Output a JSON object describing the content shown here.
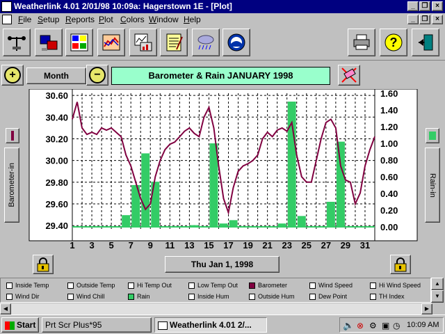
{
  "window": {
    "title": "Weatherlink 4.01    2/01/98  10:09a: Hagerstown 1E - [Plot]"
  },
  "menu": [
    "File",
    "Setup",
    "Reports",
    "Plot",
    "Colors",
    "Window",
    "Help"
  ],
  "menu_underline": [
    "F",
    "S",
    "R",
    "P",
    "C",
    "W",
    "H"
  ],
  "controls": {
    "zoom_in": "+",
    "zoom_out": "−",
    "period_label": "Month",
    "plot_title": "Barometer & Rain JANUARY 1998",
    "date_label": "Thu Jan 1, 1998",
    "left_axis_label": "Barometer-in",
    "right_axis_label": "Rain-in"
  },
  "legend": [
    [
      "Inside Temp",
      "Outside Temp",
      "Hi Temp Out",
      "Low Temp Out",
      "Barometer",
      "Wind Speed",
      "Hi Wind Speed"
    ],
    [
      "Wind Dir",
      "Wind Chill",
      "Rain",
      "Inside Hum",
      "Outside Hum",
      "Dew Point",
      "TH Index"
    ]
  ],
  "legend_colors": {
    "Barometer": "#800040",
    "Rain": "#33cc66"
  },
  "taskbar": {
    "start": "Start",
    "task1": "Prt Scr Plus*95",
    "task2": "Weatherlink 4.01    2/...",
    "clock": "10:09 AM"
  },
  "colors": {
    "barometer_line": "#800040",
    "rain_bar": "#33cc66",
    "title_bg": "#99ffcc"
  },
  "chart_data": {
    "type": "line",
    "title": "Barometer & Rain JANUARY 1998",
    "ylabel": "Barometer-in",
    "y2label": "Rain-in",
    "x_ticks": [
      "1",
      "3",
      "5",
      "7",
      "9",
      "11",
      "13",
      "15",
      "17",
      "19",
      "21",
      "23",
      "25",
      "27",
      "29",
      "31"
    ],
    "xlim": [
      1,
      32
    ],
    "ylim": [
      29.35,
      30.62
    ],
    "y2lim": [
      -0.05,
      1.6
    ],
    "y_ticks": [
      "29.40",
      "29.60",
      "29.80",
      "30.00",
      "30.20",
      "30.40",
      "30.60"
    ],
    "y2_ticks": [
      "0.00",
      "0.20",
      "0.40",
      "0.60",
      "0.80",
      "1.00",
      "1.20",
      "1.40",
      "1.60"
    ],
    "grid": true,
    "series": [
      {
        "name": "Barometer",
        "x": [
          1.0,
          1.5,
          2.0,
          2.5,
          3.0,
          3.5,
          4.0,
          4.5,
          5.0,
          5.5,
          6.0,
          6.5,
          7.0,
          7.5,
          8.0,
          8.5,
          9.0,
          9.5,
          10.0,
          10.5,
          11.0,
          11.5,
          12.0,
          12.5,
          13.0,
          13.5,
          14.0,
          14.5,
          15.0,
          15.5,
          16.0,
          16.5,
          17.0,
          17.5,
          18.0,
          18.5,
          19.0,
          19.5,
          20.0,
          20.5,
          21.0,
          21.5,
          22.0,
          22.5,
          23.0,
          23.5,
          24.0,
          24.5,
          25.0,
          25.5,
          26.0,
          26.5,
          27.0,
          27.5,
          28.0,
          28.5,
          29.0,
          29.5,
          30.0,
          30.5,
          31.0,
          31.5,
          32.0
        ],
        "values": [
          30.38,
          30.54,
          30.3,
          30.24,
          30.26,
          30.24,
          30.3,
          30.28,
          30.3,
          30.26,
          30.22,
          30.05,
          29.95,
          29.8,
          29.65,
          29.55,
          29.6,
          29.85,
          30.0,
          30.1,
          30.15,
          30.17,
          30.22,
          30.27,
          30.3,
          30.25,
          30.22,
          30.4,
          30.49,
          30.3,
          29.95,
          29.65,
          29.52,
          29.75,
          29.9,
          29.95,
          29.97,
          30.0,
          30.05,
          30.2,
          30.26,
          30.22,
          30.28,
          30.3,
          30.27,
          30.35,
          30.05,
          29.85,
          29.8,
          29.8,
          30.0,
          30.2,
          30.35,
          30.38,
          30.3,
          29.95,
          29.82,
          29.8,
          29.6,
          29.7,
          29.95,
          30.1,
          30.22
        ]
      },
      {
        "name": "Rain",
        "type": "bar",
        "x": [
          6.5,
          7.5,
          8.5,
          9.5,
          13.5,
          15.5,
          16.5,
          17.5,
          22.5,
          23.5,
          24.5,
          27.5,
          28.5
        ],
        "values": [
          0.14,
          0.5,
          0.88,
          0.54,
          0.02,
          1.0,
          0.04,
          0.08,
          0.04,
          1.5,
          0.13,
          0.3,
          1.02
        ]
      }
    ]
  }
}
